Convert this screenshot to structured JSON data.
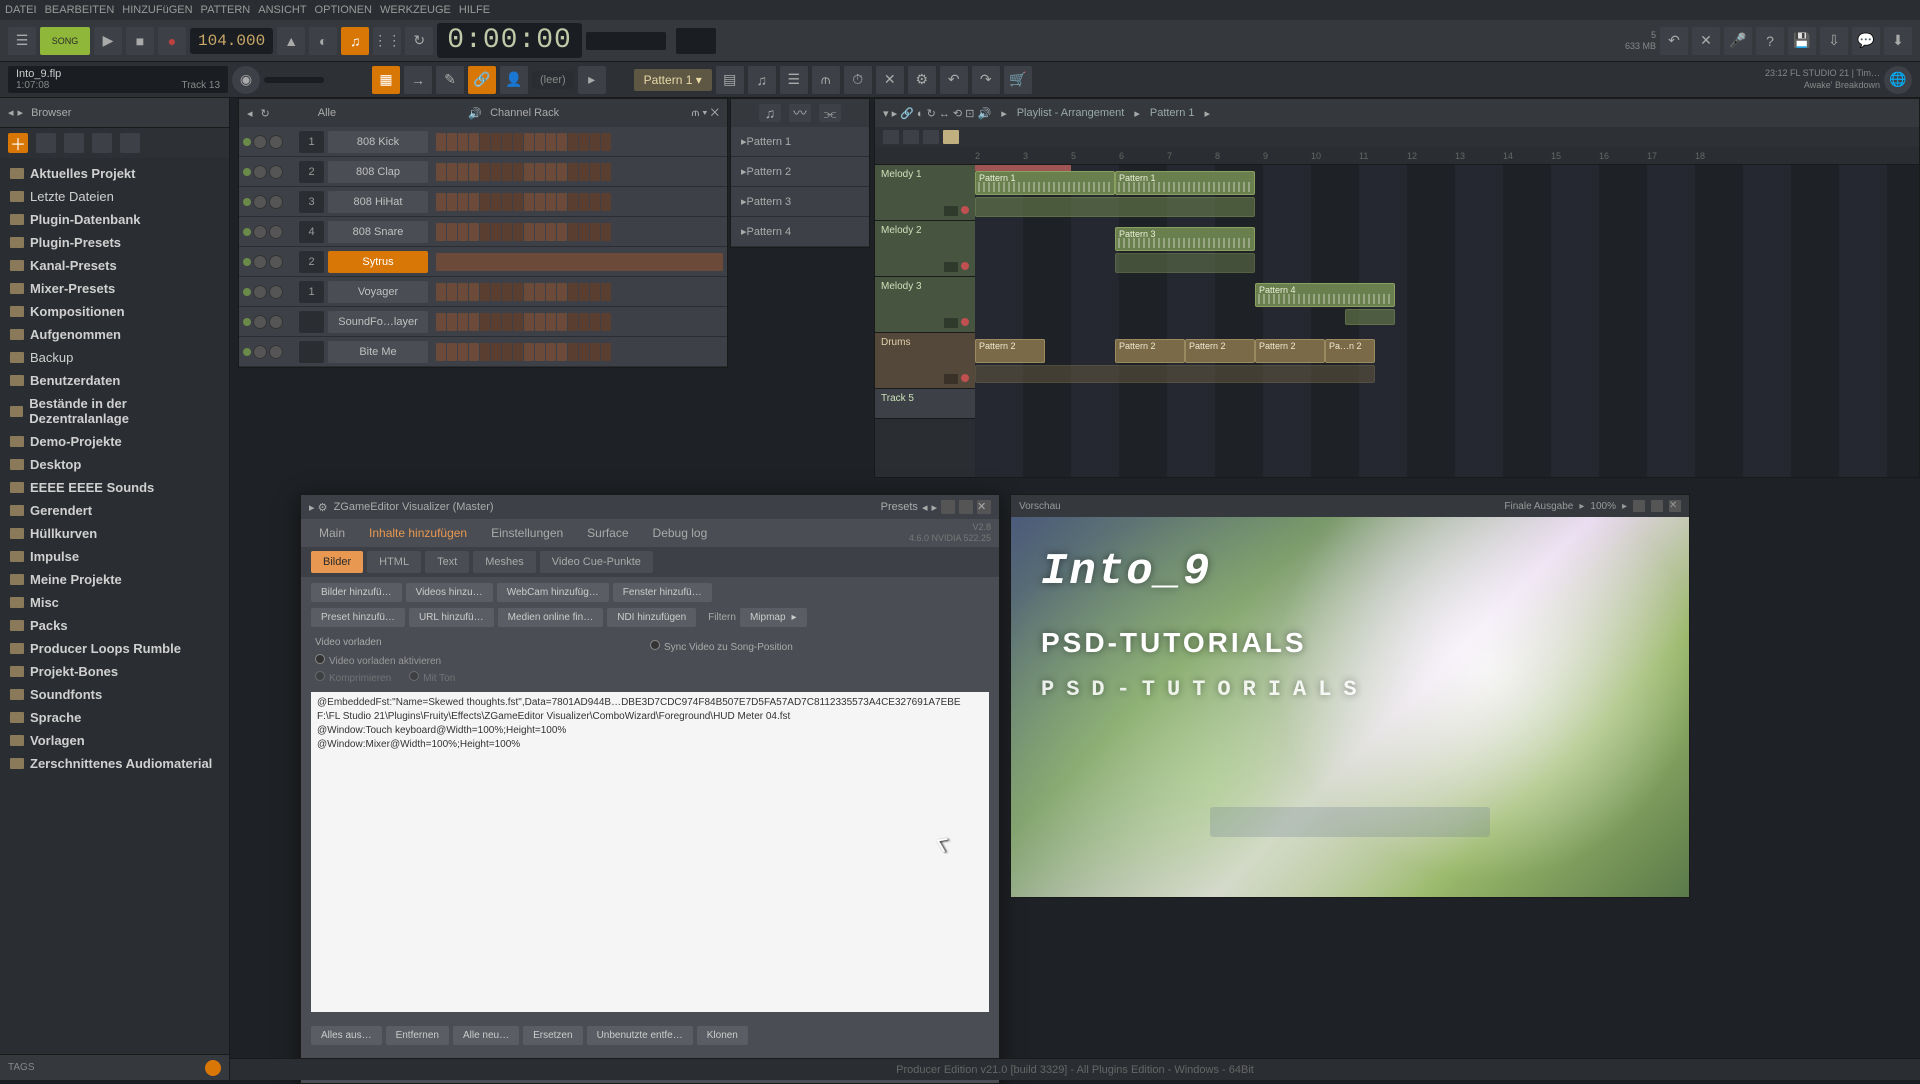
{
  "menu": {
    "items": [
      "DATEI",
      "BEARBEITEN",
      "HINZUFüGEN",
      "PATTERN",
      "ANSICHT",
      "OPTIONEN",
      "WERKZEUGE",
      "HILFE"
    ]
  },
  "transport": {
    "mode": "SONG",
    "tempo": "104.000",
    "time": "0:00:00",
    "cpu": "5",
    "mem": "633 MB"
  },
  "hint": {
    "title": "Into_9.flp",
    "sub": "1:07:08",
    "right": "Track 13"
  },
  "pattern_selector": "Pattern 1",
  "snap": "(leer)",
  "project_info": {
    "line1": "23:12  FL STUDIO 21 | Tim…",
    "line2": "Awake' Breakdown"
  },
  "browser": {
    "title": "Browser",
    "filter": "Alle",
    "items": [
      "Aktuelles Projekt",
      "Letzte Dateien",
      "Plugin-Datenbank",
      "Plugin-Presets",
      "Kanal-Presets",
      "Mixer-Presets",
      "Kompositionen",
      "Aufgenommen",
      "Backup",
      "Benutzerdaten",
      "Bestände in der Dezentralanlage",
      "Demo-Projekte",
      "Desktop",
      "EEEE EEEE Sounds",
      "Gerendert",
      "Hüllkurven",
      "Impulse",
      "Meine Projekte",
      "Misc",
      "Packs",
      "Producer Loops Rumble",
      "Projekt-Bones",
      "Soundfonts",
      "Sprache",
      "Vorlagen",
      "Zerschnittenes Audiomaterial"
    ],
    "tags": "TAGS"
  },
  "channel_rack": {
    "title": "Channel Rack",
    "channels": [
      {
        "num": "1",
        "name": "808 Kick",
        "active": false
      },
      {
        "num": "2",
        "name": "808 Clap",
        "active": false
      },
      {
        "num": "3",
        "name": "808 HiHat",
        "active": false
      },
      {
        "num": "4",
        "name": "808 Snare",
        "active": false
      },
      {
        "num": "2",
        "name": "Sytrus",
        "active": true
      },
      {
        "num": "1",
        "name": "Voyager",
        "active": false
      },
      {
        "num": "",
        "name": "SoundFo…layer",
        "active": false
      },
      {
        "num": "",
        "name": "Bite Me",
        "active": false
      }
    ]
  },
  "pattern_picker": {
    "items": [
      "Pattern 1",
      "Pattern 2",
      "Pattern 3",
      "Pattern 4"
    ]
  },
  "playlist": {
    "title": "Playlist - Arrangement",
    "crumb": "Pattern 1",
    "ruler": [
      "2",
      "3",
      "5",
      "6",
      "7",
      "8",
      "9",
      "10",
      "11",
      "12",
      "13",
      "14",
      "15",
      "16",
      "17",
      "18"
    ],
    "tracks": [
      "Melody 1",
      "Melody 2",
      "Melody 3",
      "Drums",
      "Track 5"
    ],
    "clips": {
      "p1": "Pattern 1",
      "p2": "Pattern 2",
      "p3": "Pattern 3",
      "p4": "Pattern 4",
      "pn2": "Pa…n 2"
    }
  },
  "zge": {
    "title": "ZGameEditor Visualizer (Master)",
    "presets_label": "Presets",
    "version": "V2.8",
    "build": "4.6.0 NVIDIA 522.25",
    "tabs": [
      "Main",
      "Inhalte hinzufügen",
      "Einstellungen",
      "Surface",
      "Debug log"
    ],
    "active_tab": 1,
    "subtabs": [
      "Bilder",
      "HTML",
      "Text",
      "Meshes",
      "Video Cue-Punkte"
    ],
    "active_subtab": 0,
    "row1": [
      "Bilder hinzufü…",
      "Videos hinzu…",
      "WebCam hinzufüg…",
      "Fenster hinzufü…"
    ],
    "row2": [
      "Preset hinzufü…",
      "URL hinzufü…",
      "Medien online fin…",
      "NDI hinzufügen"
    ],
    "filter_label": "Filtern",
    "mipmap_label": "Mipmap",
    "preload_section": "Video vorladen",
    "sync_label": "Sync Video zu Song-Position",
    "preload_opts": [
      "Video vorladen aktivieren",
      "Komprimieren",
      "Mit Ton"
    ],
    "text_lines": [
      "@EmbeddedFst:\"Name=Skewed thoughts.fst\",Data=7801AD944B…DBE3D7CDC974F84B507E7D5FA57AD7C8112335573A4CE327691A7EBE",
      "F:\\FL Studio 21\\Plugins\\Fruity\\Effects\\ZGameEditor Visualizer\\ComboWizard\\Foreground\\HUD Meter 04.fst",
      "@Window:Touch keyboard@Width=100%;Height=100%",
      "@Window:Mixer@Width=100%;Height=100%"
    ],
    "footer": [
      "Alles aus…",
      "Entfernen",
      "Alle neu…",
      "Ersetzen",
      "Unbenutzte entfe…",
      "Klonen"
    ]
  },
  "preview": {
    "title": "Vorschau",
    "final_label": "Finale Ausgabe",
    "zoom": "100%",
    "overlay1": "Into_9",
    "overlay2": "PSD-TUTORIALS",
    "overlay3": "PSD-TUTORIALS"
  },
  "statusbar": "Producer Edition v21.0 [build 3329] - All Plugins Edition - Windows - 64Bit"
}
